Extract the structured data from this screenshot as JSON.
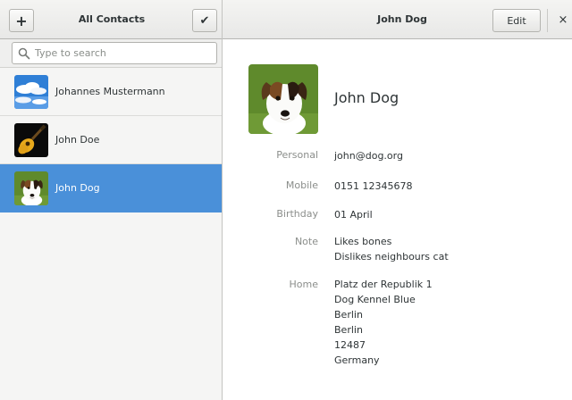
{
  "header": {
    "left_title": "All Contacts",
    "right_title": "John Dog",
    "add_label": "+",
    "select_label": "✔",
    "edit_label": "Edit",
    "close_label": "×"
  },
  "search": {
    "placeholder": "Type to search",
    "value": ""
  },
  "contacts": [
    {
      "name": "Johannes Mustermann",
      "avatar": "sky-clouds-image",
      "selected": false
    },
    {
      "name": "John Doe",
      "avatar": "guitar-image",
      "selected": false
    },
    {
      "name": "John Dog",
      "avatar": "dog-image",
      "selected": true
    }
  ],
  "detail": {
    "name": "John Dog",
    "fields": {
      "personal": {
        "label": "Personal",
        "value": "john@dog.org"
      },
      "mobile": {
        "label": "Mobile",
        "value": "0151 12345678"
      },
      "birthday": {
        "label": "Birthday",
        "value": "01 April"
      },
      "note": {
        "label": "Note",
        "lines": [
          "Likes bones",
          "Dislikes neighbours cat"
        ]
      },
      "home": {
        "label": "Home",
        "lines": [
          "Platz der Republik 1",
          "Dog Kennel Blue",
          "Berlin",
          "Berlin",
          "12487",
          "Germany"
        ]
      }
    }
  },
  "colors": {
    "selection": "#4a90d9",
    "header_bg": "#ededeb",
    "sidebar_bg": "#f5f5f4",
    "label_text": "#8b8e8b"
  }
}
